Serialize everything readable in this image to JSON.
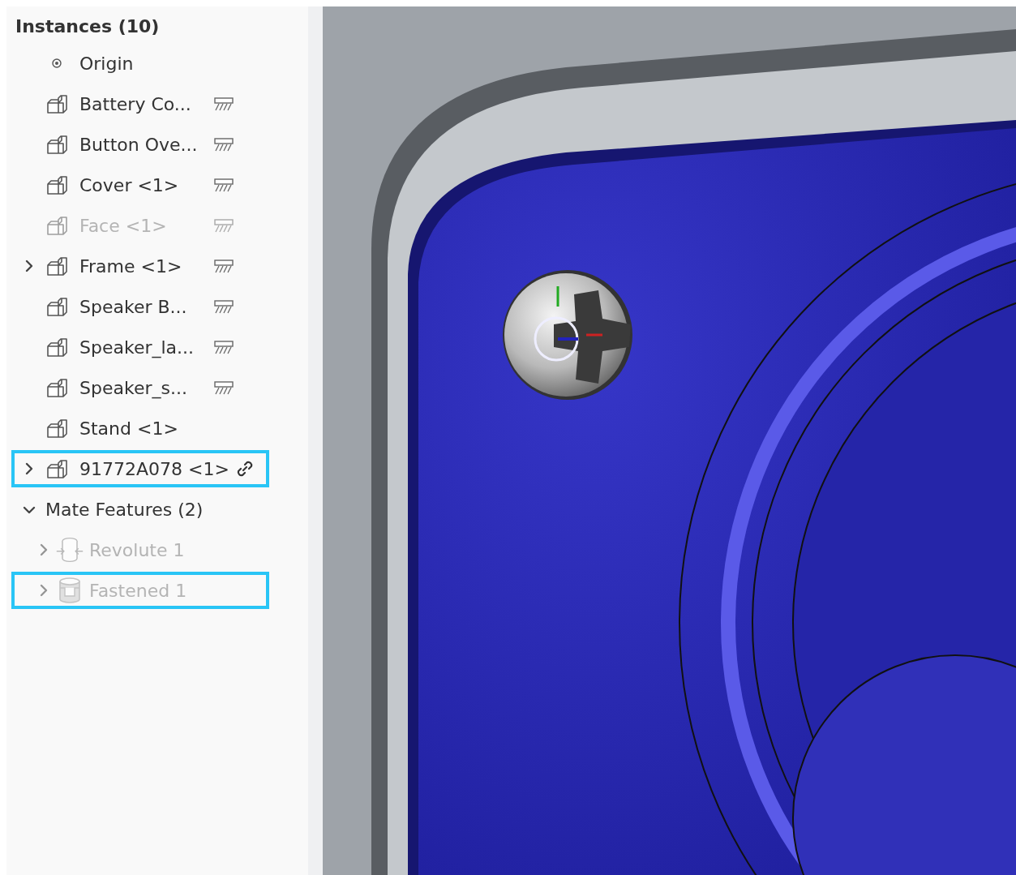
{
  "instances_panel": {
    "title": "Instances (10)",
    "instances": [
      {
        "kind": "origin",
        "label": "Origin",
        "expandable": false,
        "fixed": false,
        "linked": false,
        "suppressed": false,
        "highlighted": false
      },
      {
        "kind": "part",
        "label": "Battery Co...",
        "expandable": false,
        "fixed": true,
        "linked": false,
        "suppressed": false,
        "highlighted": false
      },
      {
        "kind": "part",
        "label": "Button Ove...",
        "expandable": false,
        "fixed": true,
        "linked": false,
        "suppressed": false,
        "highlighted": false
      },
      {
        "kind": "part",
        "label": "Cover <1>",
        "expandable": false,
        "fixed": true,
        "linked": false,
        "suppressed": false,
        "highlighted": false
      },
      {
        "kind": "part",
        "label": "Face <1>",
        "expandable": false,
        "fixed": true,
        "linked": false,
        "suppressed": true,
        "highlighted": false
      },
      {
        "kind": "part",
        "label": "Frame <1>",
        "expandable": true,
        "fixed": true,
        "linked": false,
        "suppressed": false,
        "highlighted": false
      },
      {
        "kind": "part",
        "label": "Speaker B...",
        "expandable": false,
        "fixed": true,
        "linked": false,
        "suppressed": false,
        "highlighted": false
      },
      {
        "kind": "part",
        "label": "Speaker_la...",
        "expandable": false,
        "fixed": true,
        "linked": false,
        "suppressed": false,
        "highlighted": false
      },
      {
        "kind": "part",
        "label": "Speaker_s...",
        "expandable": false,
        "fixed": true,
        "linked": false,
        "suppressed": false,
        "highlighted": false
      },
      {
        "kind": "part",
        "label": "Stand <1>",
        "expandable": false,
        "fixed": false,
        "linked": false,
        "suppressed": false,
        "highlighted": false
      },
      {
        "kind": "part",
        "label": "91772A078 <1>",
        "expandable": true,
        "fixed": false,
        "linked": true,
        "suppressed": false,
        "highlighted": true
      }
    ],
    "mate_features": {
      "title": "Mate Features (2)",
      "expanded": true,
      "items": [
        {
          "kind": "revolute",
          "label": "Revolute 1",
          "expandable": true,
          "suppressed": true,
          "highlighted": false
        },
        {
          "kind": "fastened",
          "label": "Fastened 1",
          "expandable": true,
          "suppressed": true,
          "highlighted": true
        }
      ]
    }
  }
}
